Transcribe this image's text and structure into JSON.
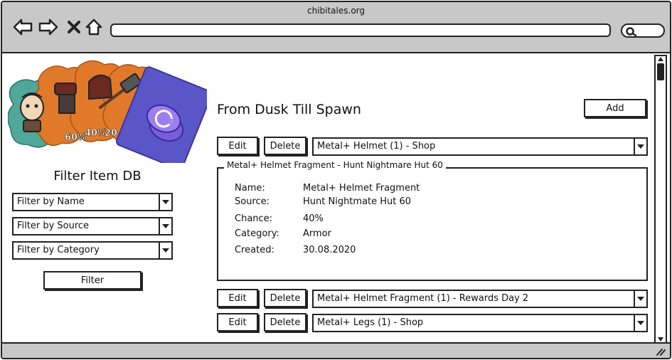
{
  "browser": {
    "site": "chibitales.org"
  },
  "sidebar": {
    "title": "Filter Item DB",
    "filters": [
      {
        "label": "Filter by Name"
      },
      {
        "label": "Filter by Source"
      },
      {
        "label": "Filter by Category"
      }
    ],
    "filter_button": "Filter",
    "hero_badges": [
      "60%",
      "40%",
      "20"
    ]
  },
  "main": {
    "title": "From Dusk Till Spawn",
    "add_button": "Add",
    "edit_label": "Edit",
    "delete_label": "Delete",
    "rows": [
      {
        "selection": "Metal+ Helmet (1) - Shop"
      },
      {
        "selection": "Metal+ Helmet Fragment (1) - Rewards Day 2"
      },
      {
        "selection": "Metal+ Legs (1) - Shop"
      }
    ],
    "details": {
      "legend": "Metal+ Helmet Fragment - Hunt Nightmare Hut 60",
      "fields": [
        {
          "label": "Name:",
          "value": "Metal+ Helmet Fragment"
        },
        {
          "label": "Source:",
          "value": "Hunt Nightmate Hut 60"
        },
        {
          "label": "Chance:",
          "value": "40%"
        },
        {
          "label": "Category:",
          "value": "Armor"
        },
        {
          "label": "Created:",
          "value": "30.08.2020"
        }
      ]
    }
  },
  "colors": {
    "chrome": "#c8c8c8",
    "ink": "#222222",
    "teal": "#4fa89a",
    "orange": "#e07a2a",
    "card_blue": "#5a56c8",
    "coin_purple": "#9c7ef0"
  }
}
